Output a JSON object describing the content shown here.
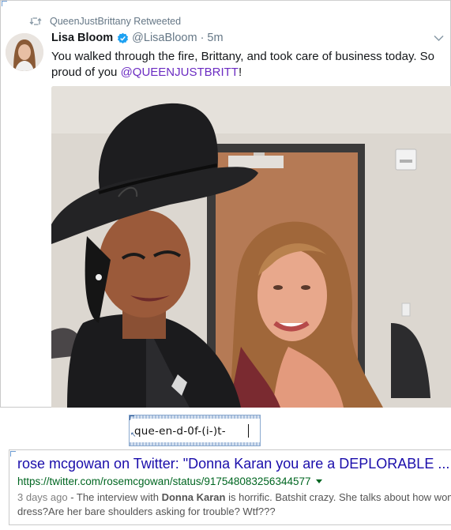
{
  "retweet": {
    "icon": "retweet-icon",
    "label": "QueenJustBrittany Retweeted"
  },
  "tweet": {
    "display_name": "Lisa Bloom",
    "handle": "@LisaBloom",
    "separator": "·",
    "time": "5m",
    "text_main": "You walked through the fire, Brittany, and took care of business today. So proud of you ",
    "mention": "@QUEENJUSTBRITT",
    "text_end": "!",
    "mention_color": "#6b2bc2",
    "verified_color": "#1da1f2"
  },
  "search_box": {
    "value": "que-en-d-0f-(i-)t-"
  },
  "search_result": {
    "title": "rose mcgowan on Twitter: \"Donna Karan you are a DEPLORABLE ...",
    "url": "https://twitter.com/rosemcgowan/status/917548083256344577",
    "snippet_date": "3 days ago",
    "snippet_dash": " - The interview with ",
    "snippet_bold": "Donna Karan",
    "snippet_rest": " is horrific. Batshit crazy. She talks about how wome",
    "snippet_line2": "dress?Are her bare shoulders asking for trouble? Wtf???",
    "title_color": "#1a0dab",
    "url_color": "#006621"
  }
}
